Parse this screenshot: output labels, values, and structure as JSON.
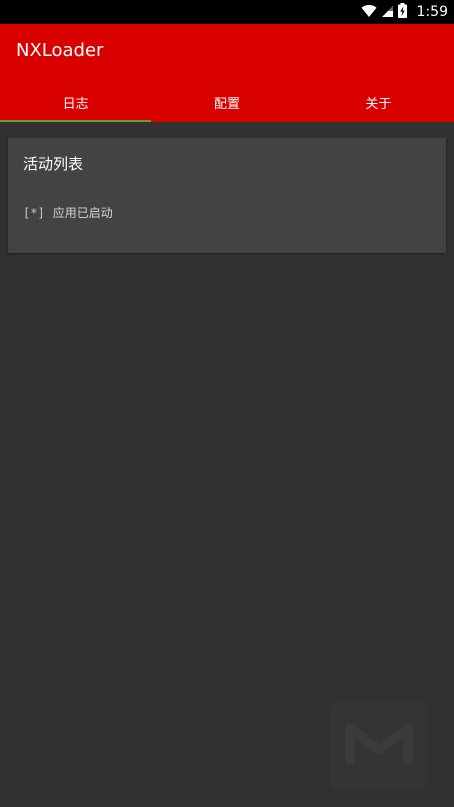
{
  "status_bar": {
    "time": "1:59",
    "icons": [
      "wifi-icon",
      "cell-signal-icon",
      "battery-icon"
    ]
  },
  "app_bar": {
    "title": "NXLoader",
    "background": "#d90000"
  },
  "tabs": [
    {
      "label": "日志",
      "active": true
    },
    {
      "label": "配置",
      "active": false
    },
    {
      "label": "关于",
      "active": false
    }
  ],
  "tab_indicator_color": "#6d9b28",
  "card": {
    "title": "活动列表",
    "logs": [
      {
        "prefix": "[*]",
        "message": "应用已启动"
      }
    ]
  },
  "background": "#313131"
}
